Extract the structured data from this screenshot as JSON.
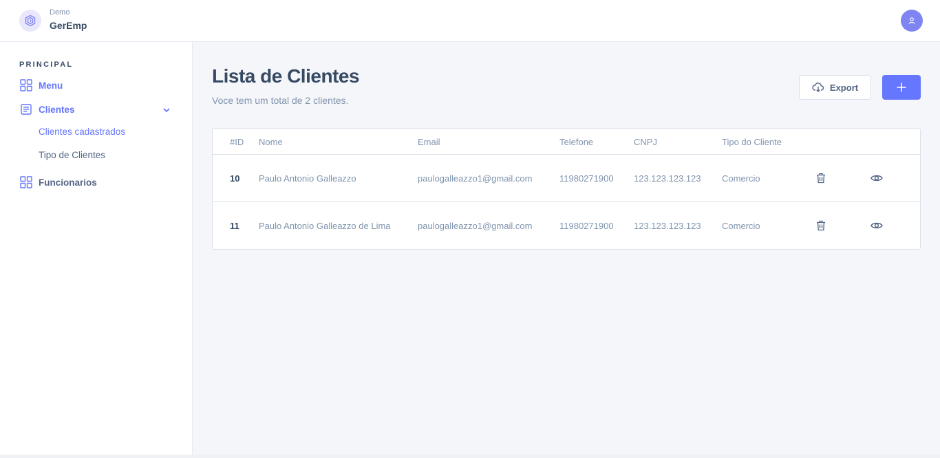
{
  "app": {
    "label": "Demo",
    "name": "GerEmp"
  },
  "sidebar": {
    "section": "PRINCIPAL",
    "items": [
      {
        "label": "Menu",
        "icon": "grid-icon"
      },
      {
        "label": "Clientes",
        "icon": "list-icon",
        "sub": [
          "Clientes cadastrados",
          "Tipo de Clientes"
        ]
      },
      {
        "label": "Funcionarios",
        "icon": "grid-icon"
      }
    ]
  },
  "main": {
    "title": "Lista de Clientes",
    "subtitle": "Voce tem um total de 2 clientes.",
    "export_label": "Export"
  },
  "table": {
    "columns": [
      "#ID",
      "Nome",
      "Email",
      "Telefone",
      "CNPJ",
      "Tipo do Cliente"
    ],
    "rows": [
      {
        "id": "10",
        "nome": "Paulo Antonio Galleazzo",
        "email": "paulogalleazzo1@gmail.com",
        "telefone": "11980271900",
        "cnpj": "123.123.123.123",
        "tipo": "Comercio"
      },
      {
        "id": "11",
        "nome": "Paulo Antonio Galleazzo de Lima",
        "email": "paulogalleazzo1@gmail.com",
        "telefone": "11980271900",
        "cnpj": "123.123.123.123",
        "tipo": "Comercio"
      }
    ]
  },
  "colors": {
    "accent": "#6576ff",
    "avatar": "#7f84f3",
    "heading": "#364a63",
    "muted": "#8094ae"
  }
}
